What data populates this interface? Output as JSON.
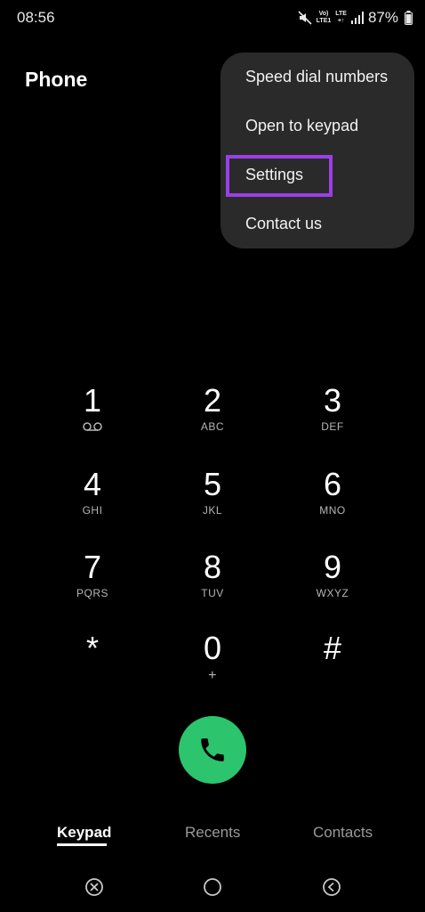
{
  "status_bar": {
    "time": "08:56",
    "network_top": "Vo)",
    "network_bottom": "LTE1",
    "lte_top": "LTE",
    "lte_bottom": "+↑",
    "battery_percent": "87%"
  },
  "app": {
    "title": "Phone"
  },
  "menu": {
    "items": [
      {
        "label": "Speed dial numbers"
      },
      {
        "label": "Open to keypad"
      },
      {
        "label": "Settings"
      },
      {
        "label": "Contact us"
      }
    ],
    "highlight_color": "#9b3fe6"
  },
  "keypad": {
    "keys": [
      {
        "digit": "1",
        "letters": ""
      },
      {
        "digit": "2",
        "letters": "ABC"
      },
      {
        "digit": "3",
        "letters": "DEF"
      },
      {
        "digit": "4",
        "letters": "GHI"
      },
      {
        "digit": "5",
        "letters": "JKL"
      },
      {
        "digit": "6",
        "letters": "MNO"
      },
      {
        "digit": "7",
        "letters": "PQRS"
      },
      {
        "digit": "8",
        "letters": "TUV"
      },
      {
        "digit": "9",
        "letters": "WXYZ"
      },
      {
        "digit": "*",
        "letters": ""
      },
      {
        "digit": "0",
        "letters": "+"
      },
      {
        "digit": "#",
        "letters": ""
      }
    ]
  },
  "call_button": {
    "color": "#2cc46d",
    "icon": "phone-icon"
  },
  "tabs": [
    {
      "label": "Keypad",
      "active": true
    },
    {
      "label": "Recents",
      "active": false
    },
    {
      "label": "Contacts",
      "active": false
    }
  ],
  "nav_bar": {
    "icons": [
      "recent-apps-icon",
      "home-icon",
      "back-icon"
    ]
  }
}
